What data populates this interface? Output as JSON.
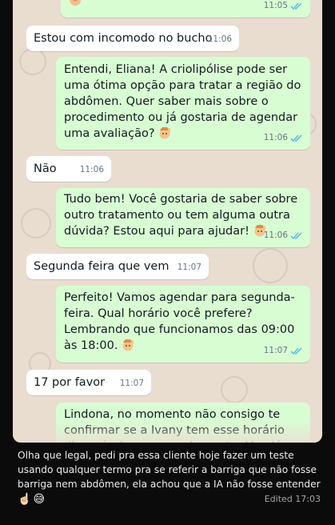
{
  "chat": {
    "messages": [
      {
        "id": "m0",
        "direction": "out",
        "text": "",
        "time": "11:05",
        "ticks": "read"
      },
      {
        "id": "m1",
        "direction": "in",
        "text": "Estou com incomodo no bucho",
        "time": "11:06"
      },
      {
        "id": "m2",
        "direction": "out",
        "text": "Entendi, Eliana! A criolipólise pode ser uma ótima opção para tratar a região do abdômen. Quer saber mais sobre o procedimento ou já gostaria de agendar uma avaliação?",
        "emoji": "woman-raising-hand-emoji",
        "time": "11:06",
        "ticks": "read"
      },
      {
        "id": "m3",
        "direction": "in",
        "text": "Não",
        "time": "11:06"
      },
      {
        "id": "m4",
        "direction": "out",
        "text": "Tudo bem! Você gostaria de saber sobre outro tratamento ou tem alguma outra dúvida? Estou aqui para ajudar!",
        "emoji": "woman-raising-hand-emoji",
        "time": "11:06",
        "ticks": "read"
      },
      {
        "id": "m5",
        "direction": "in",
        "text": "Segunda feira que vem",
        "time": "11:07"
      },
      {
        "id": "m6",
        "direction": "out",
        "text": "Perfeito! Vamos agendar para segunda-feira. Qual horário você prefere? Lembrando que funcionamos das 09:00 às 18:00.",
        "emoji": "woman-raising-hand-emoji",
        "time": "11:07",
        "ticks": "read"
      },
      {
        "id": "m7",
        "direction": "in",
        "text": "17 por favor",
        "time": "11:07"
      },
      {
        "id": "m8",
        "direction": "out",
        "text": "Lindona, no momento não consigo te confirmar se a Ivany tem esse horário disponível para agendamento. Mas já",
        "time": ""
      }
    ],
    "colors": {
      "wallpaper": "#e9ddd0",
      "incoming": "#ffffff",
      "outgoing": "#d9fdd3",
      "tick_read": "#53bdeb"
    }
  },
  "caption": {
    "text": "Olha que legal, pedi pra essa cliente hoje fazer um teste usando qualquer termo pra se referir a barriga que não fosse barriga nem abdômen, ela achou que a IA não fosse entender",
    "emojis": [
      "☝🏻",
      "😅"
    ],
    "edited_label": "Edited",
    "time": "17:03"
  }
}
